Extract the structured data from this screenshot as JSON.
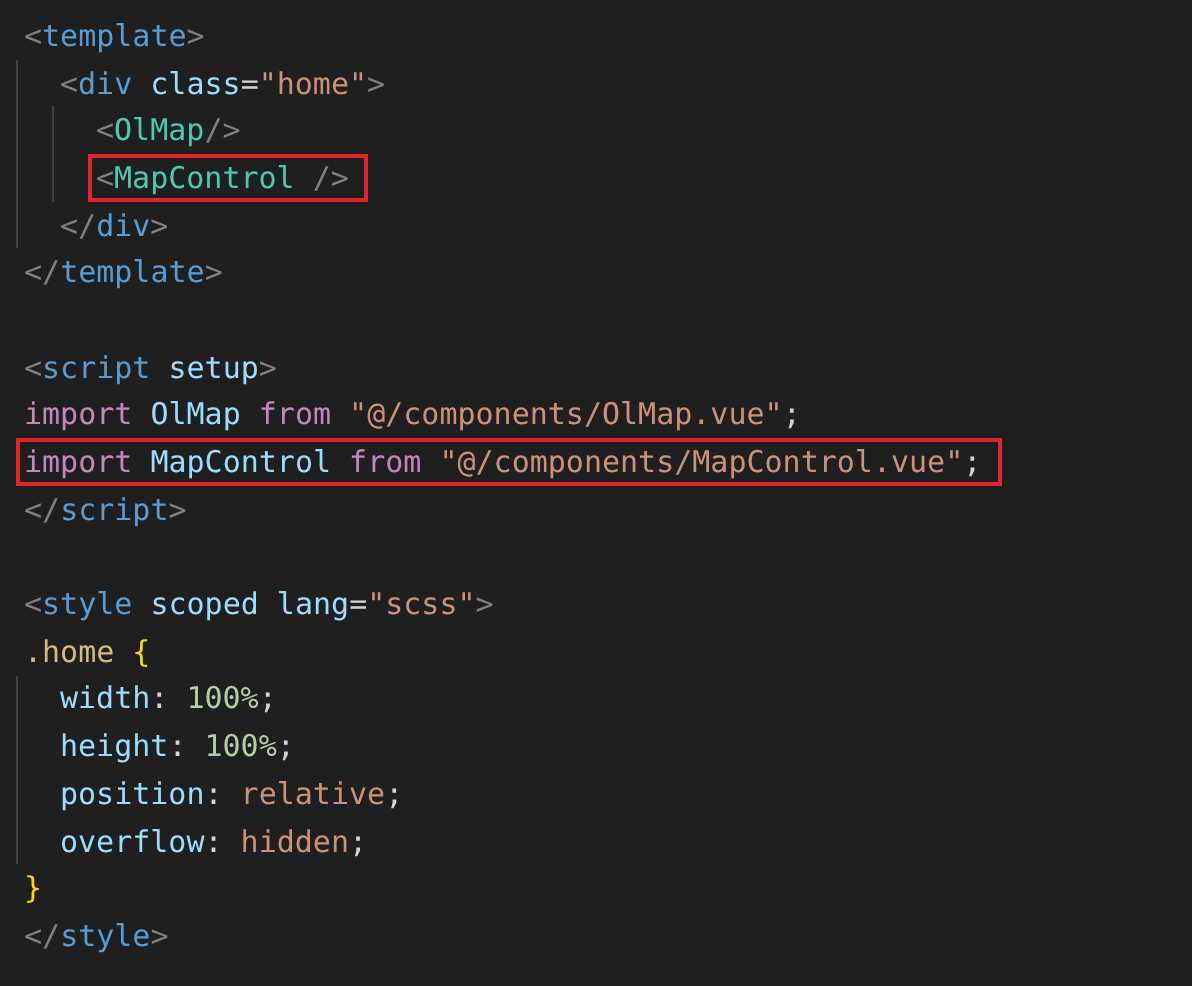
{
  "editor": {
    "lines": [
      {
        "kind": "code",
        "tokens": [
          {
            "text": "<",
            "kind": "bracket"
          },
          {
            "text": "template",
            "kind": "tag"
          },
          {
            "text": ">",
            "kind": "bracket"
          }
        ],
        "children": [
          {
            "kind": "code",
            "tokens": [
              {
                "text": "<",
                "kind": "bracket"
              },
              {
                "text": "div",
                "kind": "tag"
              },
              {
                "text": " class",
                "kind": "attr"
              },
              {
                "text": "=",
                "kind": "punct"
              },
              {
                "text": "\"home\"",
                "kind": "string"
              },
              {
                "text": ">",
                "kind": "bracket"
              }
            ],
            "children": [
              {
                "kind": "code",
                "tokens": [
                  {
                    "text": "<",
                    "kind": "bracket"
                  },
                  {
                    "text": "OlMap",
                    "kind": "component"
                  },
                  {
                    "text": "/>",
                    "kind": "bracket"
                  }
                ]
              },
              {
                "kind": "code",
                "highlighted": true,
                "tokens": [
                  {
                    "text": "<",
                    "kind": "bracket"
                  },
                  {
                    "text": "MapControl",
                    "kind": "component"
                  },
                  {
                    "text": " />",
                    "kind": "bracket"
                  }
                ]
              }
            ]
          },
          {
            "kind": "code",
            "tokens": [
              {
                "text": "</",
                "kind": "bracket"
              },
              {
                "text": "div",
                "kind": "tag"
              },
              {
                "text": ">",
                "kind": "bracket"
              }
            ]
          }
        ]
      },
      {
        "kind": "code",
        "tokens": [
          {
            "text": "</",
            "kind": "bracket"
          },
          {
            "text": "template",
            "kind": "tag"
          },
          {
            "text": ">",
            "kind": "bracket"
          }
        ]
      },
      {
        "kind": "blank"
      },
      {
        "kind": "code",
        "tokens": [
          {
            "text": "<",
            "kind": "bracket"
          },
          {
            "text": "script",
            "kind": "tag"
          },
          {
            "text": " setup",
            "kind": "attr"
          },
          {
            "text": ">",
            "kind": "bracket"
          }
        ]
      },
      {
        "kind": "code",
        "tokens": [
          {
            "text": "import",
            "kind": "keyword"
          },
          {
            "text": " OlMap",
            "kind": "ident"
          },
          {
            "text": " from",
            "kind": "keyword"
          },
          {
            "text": " \"@/components/OlMap.vue\"",
            "kind": "string"
          },
          {
            "text": ";",
            "kind": "punct"
          }
        ]
      },
      {
        "kind": "code",
        "highlighted": true,
        "tokens": [
          {
            "text": "import",
            "kind": "keyword"
          },
          {
            "text": " MapControl",
            "kind": "ident"
          },
          {
            "text": " from",
            "kind": "keyword"
          },
          {
            "text": " \"@/components/MapControl.vue\"",
            "kind": "string"
          },
          {
            "text": ";",
            "kind": "punct"
          }
        ]
      },
      {
        "kind": "code",
        "tokens": [
          {
            "text": "</",
            "kind": "bracket"
          },
          {
            "text": "script",
            "kind": "tag"
          },
          {
            "text": ">",
            "kind": "bracket"
          }
        ]
      },
      {
        "kind": "blank"
      },
      {
        "kind": "code",
        "tokens": [
          {
            "text": "<",
            "kind": "bracket"
          },
          {
            "text": "style",
            "kind": "tag"
          },
          {
            "text": " scoped",
            "kind": "attr"
          },
          {
            "text": " lang",
            "kind": "attr"
          },
          {
            "text": "=",
            "kind": "punct"
          },
          {
            "text": "\"scss\"",
            "kind": "string"
          },
          {
            "text": ">",
            "kind": "bracket"
          }
        ]
      },
      {
        "kind": "code",
        "tokens": [
          {
            "text": ".home",
            "kind": "selector"
          },
          {
            "text": " {",
            "kind": "brace"
          }
        ],
        "children": [
          {
            "kind": "code",
            "tokens": [
              {
                "text": "width",
                "kind": "prop"
              },
              {
                "text": ":",
                "kind": "punct"
              },
              {
                "text": " 100%",
                "kind": "number"
              },
              {
                "text": ";",
                "kind": "punct"
              }
            ]
          },
          {
            "kind": "code",
            "tokens": [
              {
                "text": "height",
                "kind": "prop"
              },
              {
                "text": ":",
                "kind": "punct"
              },
              {
                "text": " 100%",
                "kind": "number"
              },
              {
                "text": ";",
                "kind": "punct"
              }
            ]
          },
          {
            "kind": "code",
            "tokens": [
              {
                "text": "position",
                "kind": "prop"
              },
              {
                "text": ":",
                "kind": "punct"
              },
              {
                "text": " relative",
                "kind": "value"
              },
              {
                "text": ";",
                "kind": "punct"
              }
            ]
          },
          {
            "kind": "code",
            "tokens": [
              {
                "text": "overflow",
                "kind": "prop"
              },
              {
                "text": ":",
                "kind": "punct"
              },
              {
                "text": " hidden",
                "kind": "value"
              },
              {
                "text": ";",
                "kind": "punct"
              }
            ]
          }
        ]
      },
      {
        "kind": "code",
        "tokens": [
          {
            "text": "}",
            "kind": "brace"
          }
        ]
      },
      {
        "kind": "code",
        "tokens": [
          {
            "text": "</",
            "kind": "bracket"
          },
          {
            "text": "style",
            "kind": "tag"
          },
          {
            "text": ">",
            "kind": "bracket"
          }
        ]
      }
    ]
  }
}
